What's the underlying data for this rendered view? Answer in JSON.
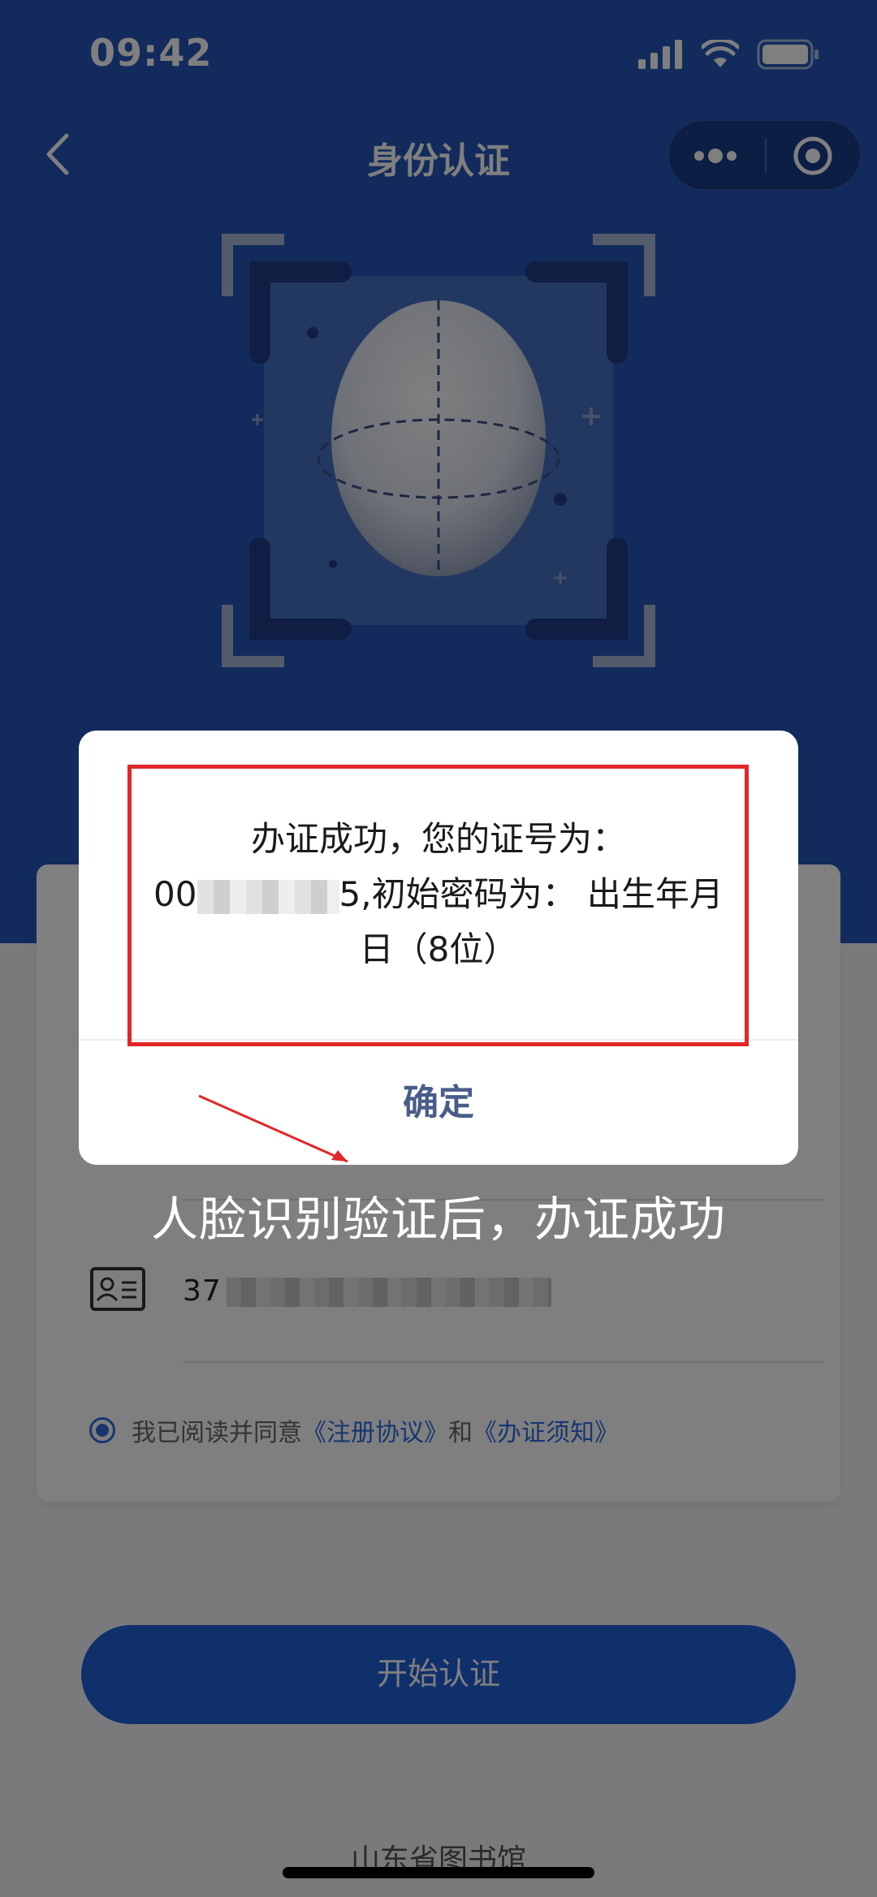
{
  "status_bar": {
    "time": "09:42"
  },
  "nav": {
    "title": "身份认证"
  },
  "form": {
    "id_prefix": "37",
    "agreement": {
      "text": "我已阅读并同意",
      "link1": "《注册协议》",
      "and": "和",
      "link2": "《办证须知》"
    },
    "start_button": "开始认证"
  },
  "footer": {
    "text": "山东省图书馆"
  },
  "modal": {
    "line1": "办证成功，您的证号为：",
    "number_prefix": "00",
    "number_suffix": "5",
    "line2_rest": ",初始密码为：  出生年月",
    "line3": "日（8位）",
    "confirm": "确定"
  },
  "annotation": {
    "caption": "人脸识别验证后，办证成功"
  },
  "colors": {
    "header_blue": "#2457b8",
    "primary": "#2060d9",
    "link": "#2e6de0",
    "highlight": "#e02828",
    "confirm_text": "#4a5d8a"
  }
}
